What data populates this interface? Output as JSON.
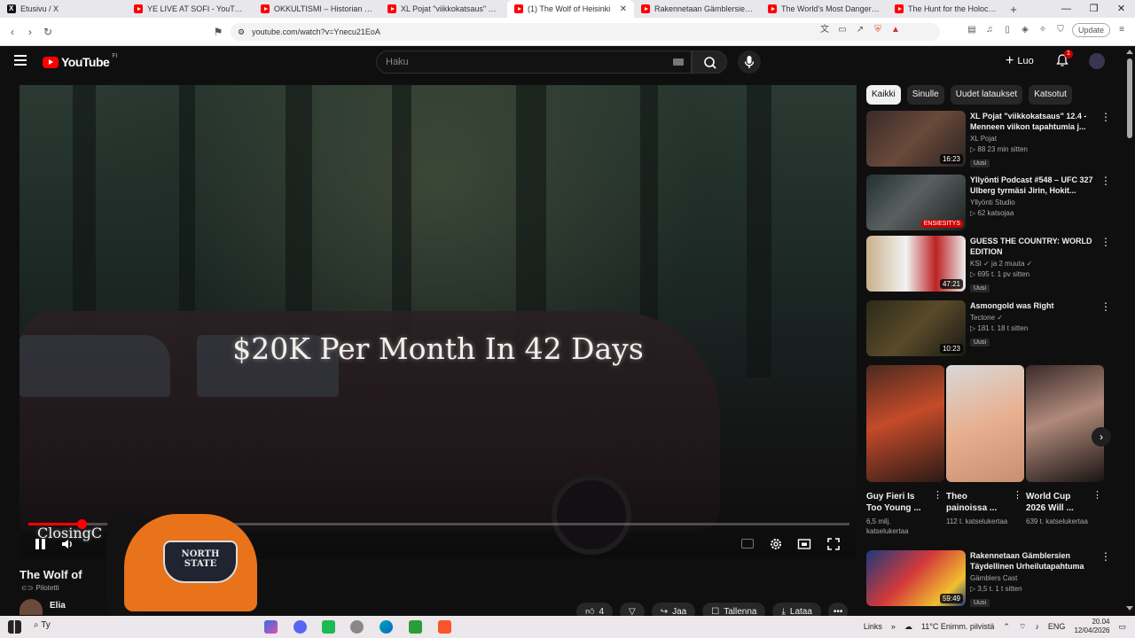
{
  "browser": {
    "tabs": [
      {
        "label": "Etusivu / X",
        "icon": "x-icon"
      },
      {
        "label": "YE LIVE AT SOFI - YouTube",
        "icon": "youtube-icon"
      },
      {
        "label": "OKKULTISMI – Historian hylätty",
        "icon": "youtube-icon"
      },
      {
        "label": "XL Pojat \"viikkokatsaus\" 12.4 -",
        "icon": "youtube-icon"
      },
      {
        "label": "(1) The Wolf of Heisinki",
        "icon": "youtube-icon",
        "active": true
      },
      {
        "label": "Rakennetaan Gämblersien Täyd",
        "icon": "youtube-icon"
      },
      {
        "label": "The World's Most Dangerous V",
        "icon": "youtube-icon"
      },
      {
        "label": "The Hunt for the Holocaust Ar",
        "icon": "youtube-icon"
      }
    ],
    "new_tab": "+",
    "url": "youtube.com/watch?v=Ynecu21EoA",
    "update_label": "Update"
  },
  "youtube": {
    "logo_text": "YouTube",
    "country_code": "FI",
    "search_placeholder": "Haku",
    "create_label": "Luo",
    "notification_count": "1"
  },
  "player": {
    "overlay_text": "$20K Per Month In 42 Days",
    "chapter_text": "ClosingC",
    "progress_fraction": 0.065,
    "cap_text": "NORTH STATE"
  },
  "video": {
    "title": "The Wolf of",
    "pinned_label": "Pilotetti",
    "channel": "Elia",
    "like_count": "4",
    "share_label": "Jaa",
    "save_label": "Tallenna",
    "download_label": "Lataa"
  },
  "chips": [
    {
      "label": "Kaikki",
      "selected": true
    },
    {
      "label": "Sinulle",
      "selected": false
    },
    {
      "label": "Uudet lataukset",
      "selected": false
    },
    {
      "label": "Katsotut",
      "selected": false
    }
  ],
  "recommendations": [
    {
      "title": "XL Pojat \"viikkokatsaus\" 12.4 - Menneen viikon tapahtumia j...",
      "channel": "XL Pojat",
      "meta": "▷ 88  23 min sitten",
      "badge": "Uusi",
      "duration": "16:23"
    },
    {
      "title": "Yllyönti Podcast #548 – UFC 327 Ulberg tyrmäsi Jirin, Hokit...",
      "channel": "Yllyönti Studio",
      "meta": "▷ 62 katsojaa",
      "badge": "",
      "duration": "ENSIESITYS"
    },
    {
      "title": "GUESS THE COUNTRY: WORLD EDITION",
      "channel": "KSI ✓ ja 2 muuta ✓",
      "meta": "▷ 695 t.  1 pv sitten",
      "badge": "Uusi",
      "duration": "47:21"
    },
    {
      "title": "Asmongold was Right",
      "channel": "Tectone ✓",
      "meta": "▷ 181 t.  18 t sitten",
      "badge": "Uusi",
      "duration": "10:23"
    },
    {
      "title": "Rakennetaan Gämblersien Täydellinen Urheilutapahtuma",
      "channel": "Gämblers Cast",
      "meta": "▷ 3,5 t.  1 t sitten",
      "badge": "Uusi",
      "duration": "59:49"
    }
  ],
  "shorts": [
    {
      "title": "Guy Fieri Is Too Young ...",
      "views": "6,5 milj. katselukertaa"
    },
    {
      "title": "Theo painoissa ...",
      "views": "112 t. katselukertaa"
    },
    {
      "title": "World Cup 2026 Will ...",
      "views": "639 t. katselukertaa"
    }
  ],
  "taskbar": {
    "search_text": "Ty",
    "links_label": "Links",
    "weather": "11°C  Enimm. pilvistä",
    "language": "ENG",
    "time": "20.04",
    "date": "12/04/2026"
  },
  "colors": {
    "accent": "#ff0000",
    "page_bg": "#0f0f0f",
    "chip_bg": "#272727"
  }
}
